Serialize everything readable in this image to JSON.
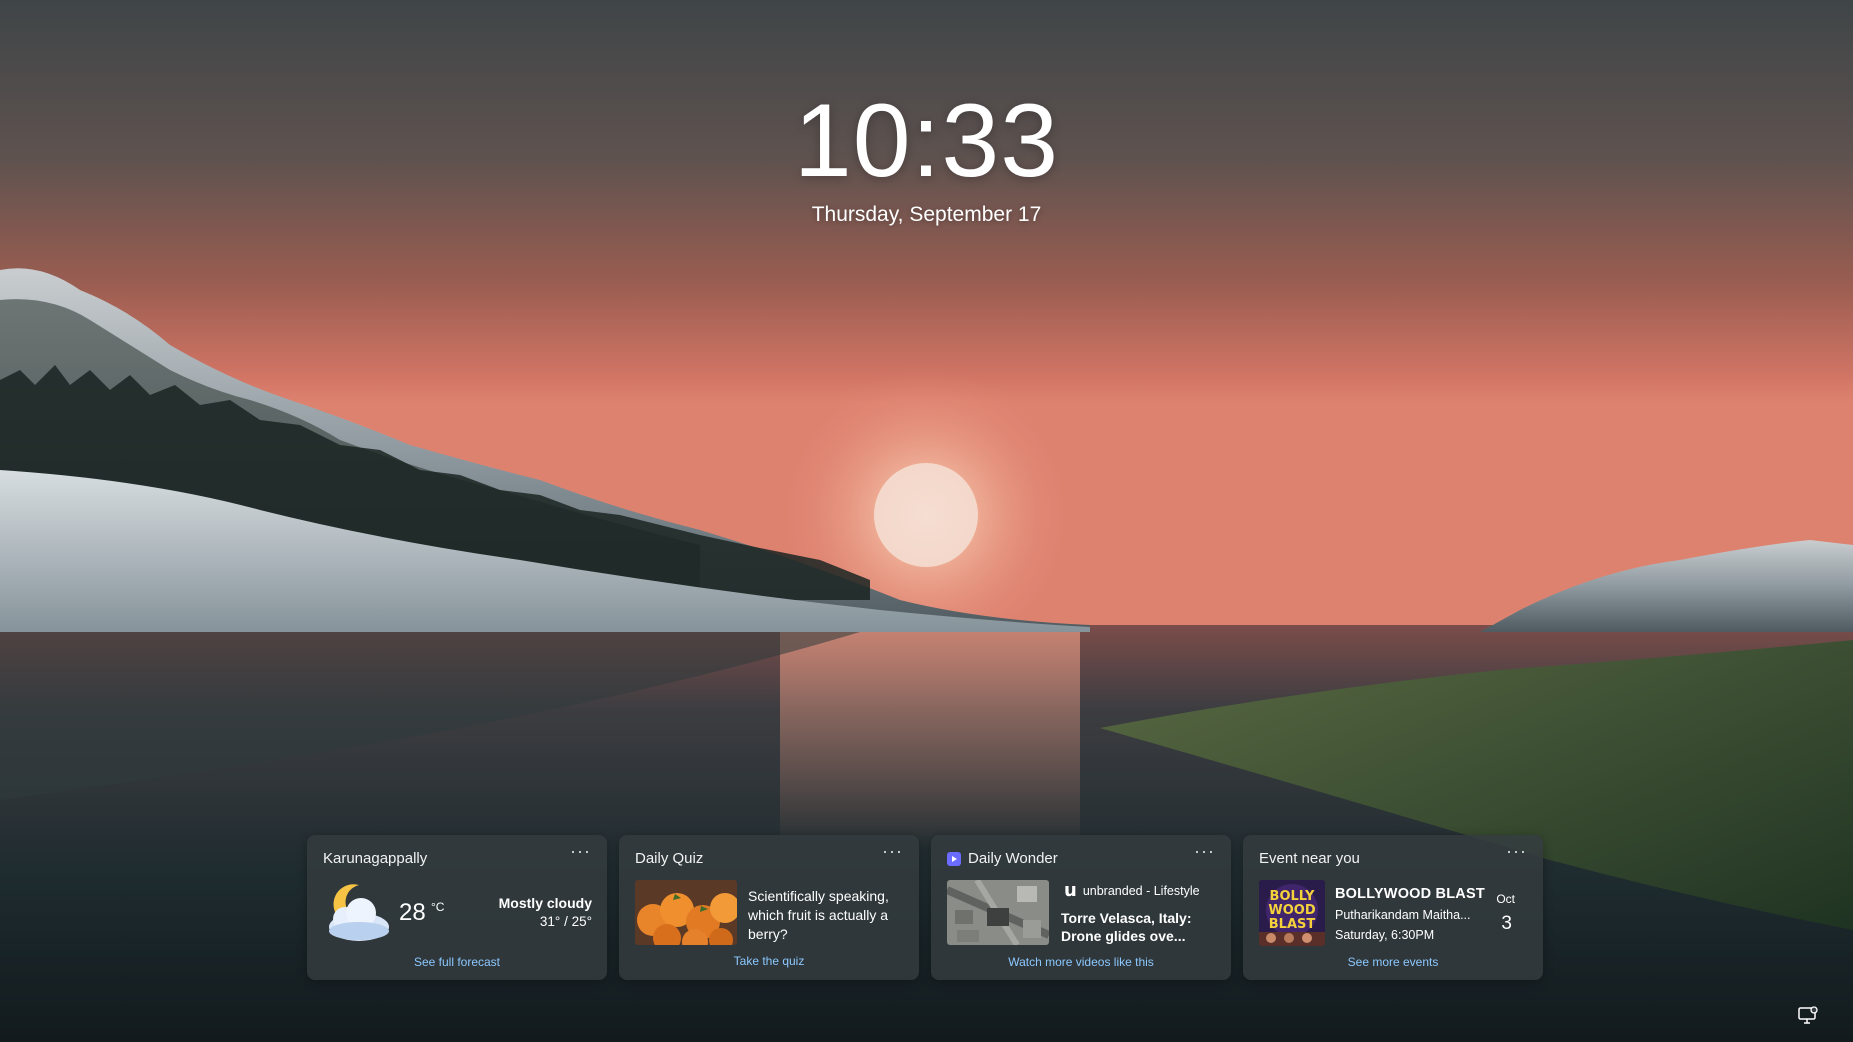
{
  "lock_screen": {
    "time": "10:33",
    "date": "Thursday, September 17"
  },
  "weather": {
    "location": "Karunagappally",
    "temperature": "28",
    "unit": "°C",
    "condition": "Mostly cloudy",
    "high_low": "31° / 25°",
    "link": "See full forecast",
    "icon": "moon-cloud-icon"
  },
  "quiz": {
    "title": "Daily Quiz",
    "question": "Scientifically speaking, which fruit is actually a berry?",
    "link": "Take the quiz"
  },
  "wonder": {
    "title": "Daily Wonder",
    "publisher_logo": "u",
    "publisher": "unbranded - Lifestyle",
    "headline": "Torre Velasca, Italy: Drone glides ove...",
    "link": "Watch more videos like this"
  },
  "event": {
    "title": "Event near you",
    "poster_text": [
      "BOLLY",
      "WOOD",
      "BLAST"
    ],
    "name": "BOLLYWOOD BLAST",
    "place": "Putharikandam Maitha...",
    "time": "Saturday, 6:30PM",
    "month": "Oct",
    "day": "3",
    "link": "See more events"
  },
  "more_label": "···",
  "colors": {
    "link": "#8cc8ff",
    "card_bg": "#343c40",
    "wonder_icon": "#6b6bff"
  }
}
